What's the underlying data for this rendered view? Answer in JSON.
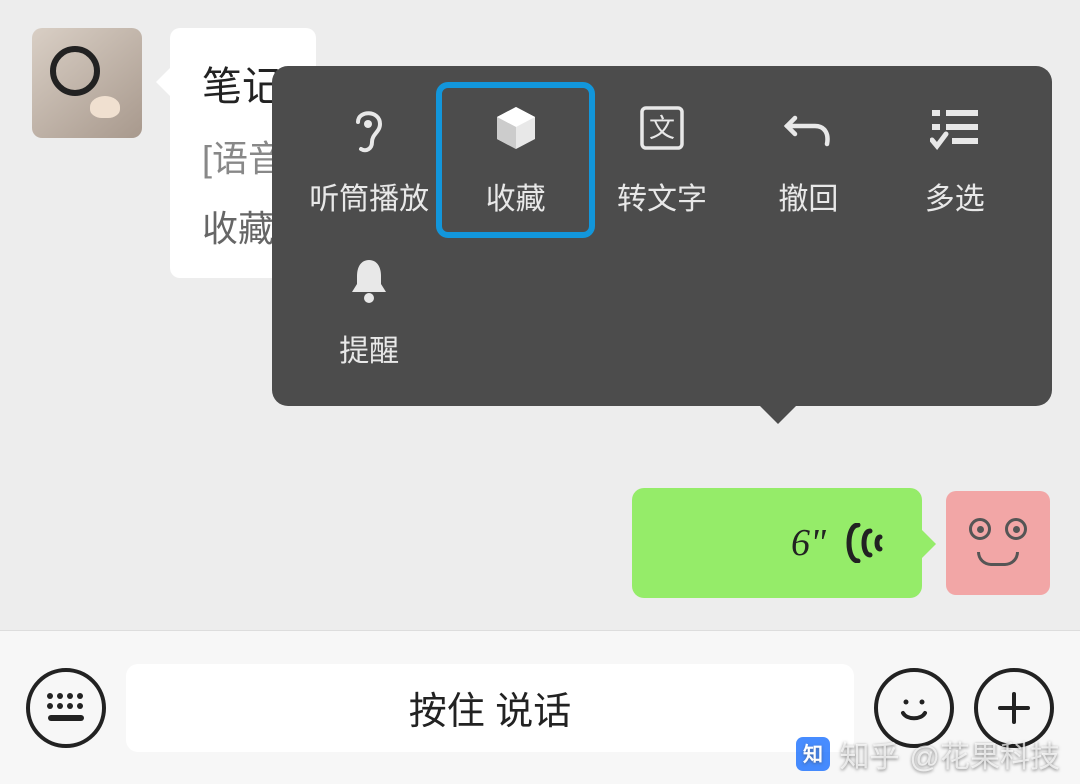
{
  "incoming": {
    "title_partial": "笔记",
    "subtitle_partial": "[语音",
    "footer_partial": "收藏"
  },
  "context_menu": {
    "items": [
      {
        "label": "听筒播放",
        "icon": "ear"
      },
      {
        "label": "收藏",
        "icon": "cube",
        "highlight": true
      },
      {
        "label": "转文字",
        "icon": "wen"
      },
      {
        "label": "撤回",
        "icon": "undo"
      },
      {
        "label": "多选",
        "icon": "checklist"
      },
      {
        "label": "提醒",
        "icon": "bell"
      }
    ]
  },
  "outgoing": {
    "duration": "6\""
  },
  "input_bar": {
    "hold_label": "按住 说话"
  },
  "watermark": {
    "prefix": "知乎",
    "author": "@花果科技"
  }
}
